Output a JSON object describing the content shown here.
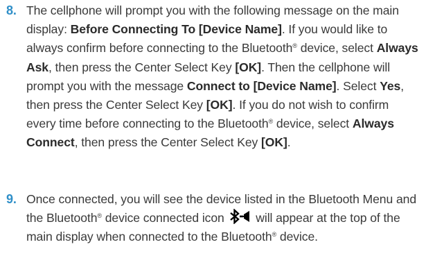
{
  "steps": [
    {
      "number": "8.",
      "t1": "The cellphone will prompt you with the following message on the main display: ",
      "b1": "Before Connecting To [Device Name]",
      "t2": ". If you would like to always confirm before connecting to the Bluetooth",
      "reg": "®",
      "t3": " device, select ",
      "b2": "Always Ask",
      "t4": ", then press the Center Select Key ",
      "b3": "[OK]",
      "t5": ". Then the cellphone will prompt you with the message ",
      "b4": "Connect to [Device Name]",
      "t6": ". Select ",
      "b5": "Yes",
      "t7": ", then press the Center Select Key ",
      "b6": "[OK]",
      "t8": ". If you do not wish to confirm every time before connecting to the Bluetooth",
      "reg2": "®",
      "t9": " device, select ",
      "b7": "Always Connect",
      "t10": ", then press the Center Select Key ",
      "b8": "[OK]",
      "t11": "."
    },
    {
      "number": "9.",
      "t1": "Once connected, you will see the device listed in the Bluetooth Menu and the Bluetooth",
      "reg": "®",
      "t2": " device connected icon ",
      "icon": "bluetooth-connected-icon",
      "t3": " will appear at the top of the main display when connected to the Bluetooth",
      "reg2": "®",
      "t4": " device."
    }
  ],
  "colors": {
    "step_number": "#2f8fc8",
    "text": "#3a3a3a"
  }
}
